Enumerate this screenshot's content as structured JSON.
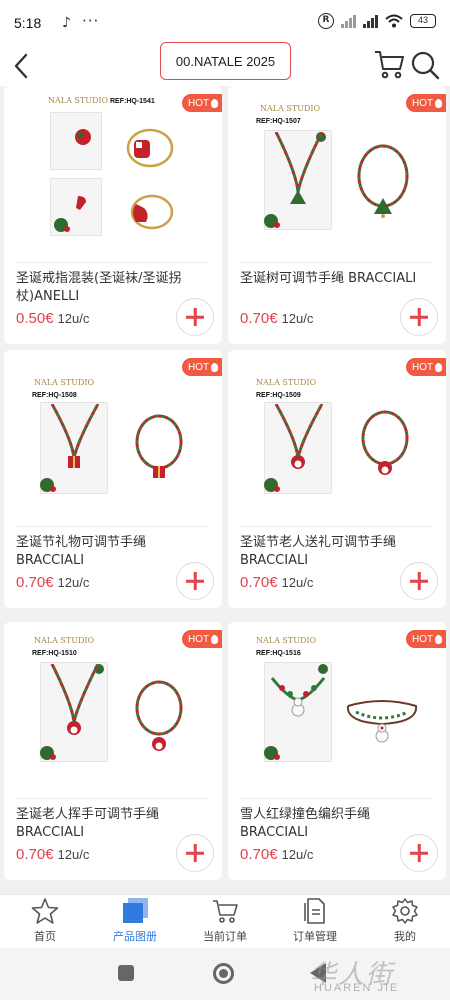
{
  "status_bar": {
    "time": "5:18",
    "battery": "43",
    "r_badge": "R"
  },
  "header": {
    "title": "00.NATALE 2025"
  },
  "products": [
    {
      "name": "圣诞戒指混装(圣诞袜/圣诞拐杖)ANELLI",
      "price": "0.50€",
      "unit": "12u/c",
      "badge": "HOT",
      "brand": "NALA STUDIO",
      "ref": "REF:HQ-1541"
    },
    {
      "name": "圣诞树可调节手绳 BRACCIALI",
      "price": "0.70€",
      "unit": "12u/c",
      "badge": "HOT",
      "brand": "NALA STUDIO",
      "ref": "REF:HQ-1507"
    },
    {
      "name": "圣诞节礼物可调节手绳 BRACCIALI",
      "price": "0.70€",
      "unit": "12u/c",
      "badge": "HOT",
      "brand": "NALA STUDIO",
      "ref": "REF:HQ-1508"
    },
    {
      "name": "圣诞节老人送礼可调节手绳 BRACCIALI",
      "price": "0.70€",
      "unit": "12u/c",
      "badge": "HOT",
      "brand": "NALA STUDIO",
      "ref": "REF:HQ-1509"
    },
    {
      "name": "圣诞老人挥手可调节手绳 BRACCIALI",
      "price": "0.70€",
      "unit": "12u/c",
      "badge": "HOT",
      "brand": "NALA STUDIO",
      "ref": "REF:HQ-1510"
    },
    {
      "name": "雪人红绿撞色编织手绳 BRACCIALI",
      "price": "0.70€",
      "unit": "12u/c",
      "badge": "HOT",
      "brand": "NALA STUDIO",
      "ref": "REF:HQ-1516"
    }
  ],
  "bottom_nav": [
    {
      "label": "首页",
      "icon": "star-icon",
      "active": false
    },
    {
      "label": "产品图册",
      "icon": "catalog-icon",
      "active": true
    },
    {
      "label": "当前订单",
      "icon": "cart-icon",
      "active": false
    },
    {
      "label": "订单管理",
      "icon": "document-icon",
      "active": false
    },
    {
      "label": "我的",
      "icon": "gear-icon",
      "active": false
    }
  ],
  "watermark": {
    "cn": "华人街",
    "en": "HUAREN JIE"
  },
  "colors": {
    "accent": "#e0434a",
    "hot_badge": "#ef5a43",
    "nav_active": "#2f7be0"
  }
}
